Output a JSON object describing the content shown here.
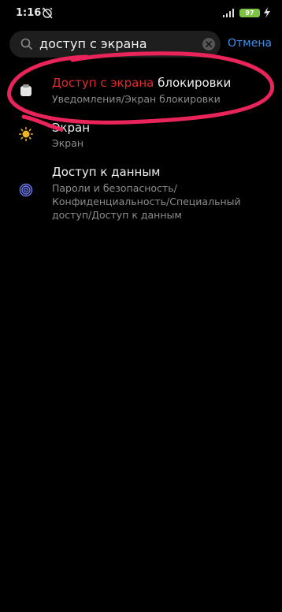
{
  "status_bar": {
    "time": "1:16",
    "battery_level": "97",
    "icons": [
      "alarm-off-icon",
      "signal-icon",
      "wifi-icon",
      "battery-icon",
      "charging-icon"
    ]
  },
  "search": {
    "query": "доступ с экрана",
    "cancel_label": "Отмена"
  },
  "results": [
    {
      "icon": "lock-screen-icon",
      "title_highlight": "Доступ с экрана",
      "title_rest": " блокировки",
      "subtitle": "Уведомления/Экран блокировки"
    },
    {
      "icon": "brightness-icon",
      "title": "Экран",
      "subtitle": "Экран"
    },
    {
      "icon": "fingerprint-icon",
      "title": "Доступ к данным",
      "subtitle": "Пароли и безопасность/Конфиденциальность/Специальный доступ/Доступ к данным"
    }
  ],
  "colors": {
    "background": "#000000",
    "highlight": "#e02b2b",
    "accent": "#3b8eea",
    "annotation": "#e8245a"
  }
}
